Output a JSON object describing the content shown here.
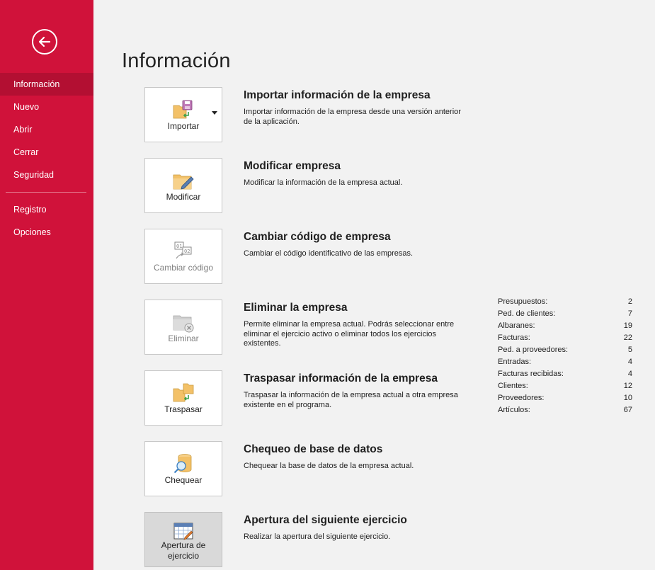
{
  "sidebar": {
    "back_label": "",
    "items": [
      {
        "label": "Información"
      },
      {
        "label": "Nuevo"
      },
      {
        "label": "Abrir"
      },
      {
        "label": "Cerrar"
      },
      {
        "label": "Seguridad"
      },
      {
        "label": "Registro"
      },
      {
        "label": "Opciones"
      }
    ]
  },
  "page": {
    "title": "Información"
  },
  "actions": [
    {
      "tile_label": "Importar",
      "title": "Importar información de la empresa",
      "description": "Importar información de la empresa desde una versión anterior de la aplicación.",
      "icon": "import-icon"
    },
    {
      "tile_label": "Modificar",
      "title": "Modificar empresa",
      "description": "Modificar la información de la empresa actual.",
      "icon": "modify-folder-icon"
    },
    {
      "tile_label": "Cambiar código",
      "title": "Cambiar código de empresa",
      "description": "Cambiar el código identificativo de las empresas.",
      "icon": "change-code-icon"
    },
    {
      "tile_label": "Eliminar",
      "title": "Eliminar la empresa",
      "description": "Permite eliminar la empresa actual. Podrás seleccionar entre eliminar el ejercicio activo o eliminar todos los ejercicios existentes.",
      "icon": "delete-folder-icon"
    },
    {
      "tile_label": "Traspasar",
      "title": "Traspasar información de la empresa",
      "description": "Traspasar la información de la empresa actual a otra empresa existente en el programa.",
      "icon": "transfer-icon"
    },
    {
      "tile_label": "Chequear",
      "title": "Chequeo de base de datos",
      "description": "Chequear la base de datos de la empresa actual.",
      "icon": "database-check-icon"
    },
    {
      "tile_label_line1": "Apertura de",
      "tile_label_line2": "ejercicio",
      "title": "Apertura del siguiente ejercicio",
      "description": "Realizar la apertura del siguiente ejercicio.",
      "icon": "calendar-icon"
    }
  ],
  "stats": [
    {
      "label": "Presupuestos:",
      "value": "2"
    },
    {
      "label": "Ped. de clientes:",
      "value": "7"
    },
    {
      "label": "Albaranes:",
      "value": "19"
    },
    {
      "label": "Facturas:",
      "value": "22"
    },
    {
      "label": "Ped. a proveedores:",
      "value": "5"
    },
    {
      "label": "Entradas:",
      "value": "4"
    },
    {
      "label": "Facturas recibidas:",
      "value": "4"
    },
    {
      "label": "Clientes:",
      "value": "12"
    },
    {
      "label": "Proveedores:",
      "value": "10"
    },
    {
      "label": "Artículos:",
      "value": "67"
    }
  ],
  "colors": {
    "sidebar": "#d0123a",
    "sidebar_active": "#b30f32",
    "background": "#f2f2f2"
  }
}
